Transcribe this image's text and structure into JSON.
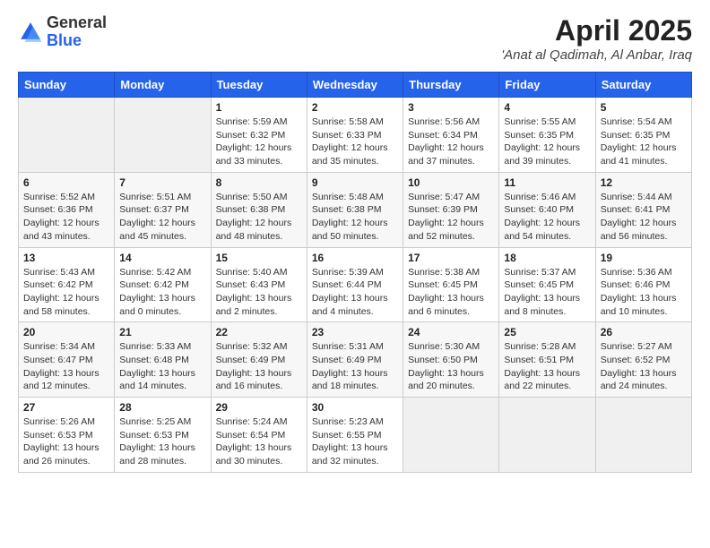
{
  "header": {
    "logo_general": "General",
    "logo_blue": "Blue",
    "month_title": "April 2025",
    "location": "'Anat al Qadimah, Al Anbar, Iraq"
  },
  "days_of_week": [
    "Sunday",
    "Monday",
    "Tuesday",
    "Wednesday",
    "Thursday",
    "Friday",
    "Saturday"
  ],
  "weeks": [
    [
      {
        "day": "",
        "sunrise": "",
        "sunset": "",
        "daylight": ""
      },
      {
        "day": "",
        "sunrise": "",
        "sunset": "",
        "daylight": ""
      },
      {
        "day": "1",
        "sunrise": "Sunrise: 5:59 AM",
        "sunset": "Sunset: 6:32 PM",
        "daylight": "Daylight: 12 hours and 33 minutes."
      },
      {
        "day": "2",
        "sunrise": "Sunrise: 5:58 AM",
        "sunset": "Sunset: 6:33 PM",
        "daylight": "Daylight: 12 hours and 35 minutes."
      },
      {
        "day": "3",
        "sunrise": "Sunrise: 5:56 AM",
        "sunset": "Sunset: 6:34 PM",
        "daylight": "Daylight: 12 hours and 37 minutes."
      },
      {
        "day": "4",
        "sunrise": "Sunrise: 5:55 AM",
        "sunset": "Sunset: 6:35 PM",
        "daylight": "Daylight: 12 hours and 39 minutes."
      },
      {
        "day": "5",
        "sunrise": "Sunrise: 5:54 AM",
        "sunset": "Sunset: 6:35 PM",
        "daylight": "Daylight: 12 hours and 41 minutes."
      }
    ],
    [
      {
        "day": "6",
        "sunrise": "Sunrise: 5:52 AM",
        "sunset": "Sunset: 6:36 PM",
        "daylight": "Daylight: 12 hours and 43 minutes."
      },
      {
        "day": "7",
        "sunrise": "Sunrise: 5:51 AM",
        "sunset": "Sunset: 6:37 PM",
        "daylight": "Daylight: 12 hours and 45 minutes."
      },
      {
        "day": "8",
        "sunrise": "Sunrise: 5:50 AM",
        "sunset": "Sunset: 6:38 PM",
        "daylight": "Daylight: 12 hours and 48 minutes."
      },
      {
        "day": "9",
        "sunrise": "Sunrise: 5:48 AM",
        "sunset": "Sunset: 6:38 PM",
        "daylight": "Daylight: 12 hours and 50 minutes."
      },
      {
        "day": "10",
        "sunrise": "Sunrise: 5:47 AM",
        "sunset": "Sunset: 6:39 PM",
        "daylight": "Daylight: 12 hours and 52 minutes."
      },
      {
        "day": "11",
        "sunrise": "Sunrise: 5:46 AM",
        "sunset": "Sunset: 6:40 PM",
        "daylight": "Daylight: 12 hours and 54 minutes."
      },
      {
        "day": "12",
        "sunrise": "Sunrise: 5:44 AM",
        "sunset": "Sunset: 6:41 PM",
        "daylight": "Daylight: 12 hours and 56 minutes."
      }
    ],
    [
      {
        "day": "13",
        "sunrise": "Sunrise: 5:43 AM",
        "sunset": "Sunset: 6:42 PM",
        "daylight": "Daylight: 12 hours and 58 minutes."
      },
      {
        "day": "14",
        "sunrise": "Sunrise: 5:42 AM",
        "sunset": "Sunset: 6:42 PM",
        "daylight": "Daylight: 13 hours and 0 minutes."
      },
      {
        "day": "15",
        "sunrise": "Sunrise: 5:40 AM",
        "sunset": "Sunset: 6:43 PM",
        "daylight": "Daylight: 13 hours and 2 minutes."
      },
      {
        "day": "16",
        "sunrise": "Sunrise: 5:39 AM",
        "sunset": "Sunset: 6:44 PM",
        "daylight": "Daylight: 13 hours and 4 minutes."
      },
      {
        "day": "17",
        "sunrise": "Sunrise: 5:38 AM",
        "sunset": "Sunset: 6:45 PM",
        "daylight": "Daylight: 13 hours and 6 minutes."
      },
      {
        "day": "18",
        "sunrise": "Sunrise: 5:37 AM",
        "sunset": "Sunset: 6:45 PM",
        "daylight": "Daylight: 13 hours and 8 minutes."
      },
      {
        "day": "19",
        "sunrise": "Sunrise: 5:36 AM",
        "sunset": "Sunset: 6:46 PM",
        "daylight": "Daylight: 13 hours and 10 minutes."
      }
    ],
    [
      {
        "day": "20",
        "sunrise": "Sunrise: 5:34 AM",
        "sunset": "Sunset: 6:47 PM",
        "daylight": "Daylight: 13 hours and 12 minutes."
      },
      {
        "day": "21",
        "sunrise": "Sunrise: 5:33 AM",
        "sunset": "Sunset: 6:48 PM",
        "daylight": "Daylight: 13 hours and 14 minutes."
      },
      {
        "day": "22",
        "sunrise": "Sunrise: 5:32 AM",
        "sunset": "Sunset: 6:49 PM",
        "daylight": "Daylight: 13 hours and 16 minutes."
      },
      {
        "day": "23",
        "sunrise": "Sunrise: 5:31 AM",
        "sunset": "Sunset: 6:49 PM",
        "daylight": "Daylight: 13 hours and 18 minutes."
      },
      {
        "day": "24",
        "sunrise": "Sunrise: 5:30 AM",
        "sunset": "Sunset: 6:50 PM",
        "daylight": "Daylight: 13 hours and 20 minutes."
      },
      {
        "day": "25",
        "sunrise": "Sunrise: 5:28 AM",
        "sunset": "Sunset: 6:51 PM",
        "daylight": "Daylight: 13 hours and 22 minutes."
      },
      {
        "day": "26",
        "sunrise": "Sunrise: 5:27 AM",
        "sunset": "Sunset: 6:52 PM",
        "daylight": "Daylight: 13 hours and 24 minutes."
      }
    ],
    [
      {
        "day": "27",
        "sunrise": "Sunrise: 5:26 AM",
        "sunset": "Sunset: 6:53 PM",
        "daylight": "Daylight: 13 hours and 26 minutes."
      },
      {
        "day": "28",
        "sunrise": "Sunrise: 5:25 AM",
        "sunset": "Sunset: 6:53 PM",
        "daylight": "Daylight: 13 hours and 28 minutes."
      },
      {
        "day": "29",
        "sunrise": "Sunrise: 5:24 AM",
        "sunset": "Sunset: 6:54 PM",
        "daylight": "Daylight: 13 hours and 30 minutes."
      },
      {
        "day": "30",
        "sunrise": "Sunrise: 5:23 AM",
        "sunset": "Sunset: 6:55 PM",
        "daylight": "Daylight: 13 hours and 32 minutes."
      },
      {
        "day": "",
        "sunrise": "",
        "sunset": "",
        "daylight": ""
      },
      {
        "day": "",
        "sunrise": "",
        "sunset": "",
        "daylight": ""
      },
      {
        "day": "",
        "sunrise": "",
        "sunset": "",
        "daylight": ""
      }
    ]
  ]
}
